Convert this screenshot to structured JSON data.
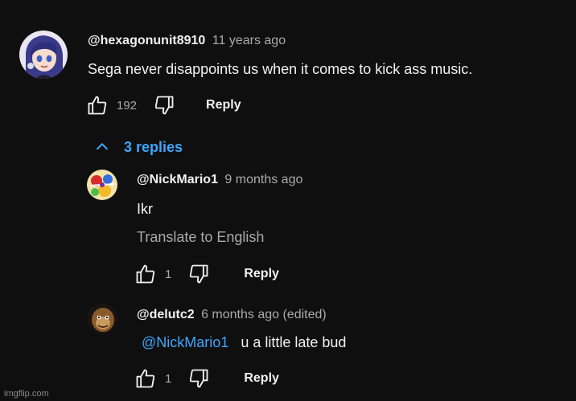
{
  "top_comment": {
    "handle": "@hexagonunit8910",
    "time": "11 years ago",
    "text": "Sega never disappoints us when it comes to kick ass music.",
    "likes": "192",
    "reply_label": "Reply"
  },
  "replies_toggle": {
    "label": "3 replies",
    "icon": "chevron-up-icon"
  },
  "replies": [
    {
      "handle": "@NickMario1",
      "time": "9 months ago",
      "text": "Ikr",
      "translate_label": "Translate to English",
      "likes": "1",
      "reply_label": "Reply"
    },
    {
      "handle": "@delutc2",
      "time": "6 months ago (edited)",
      "mention": "@NickMario1",
      "text": "u a little late bud",
      "likes": "1",
      "reply_label": "Reply"
    }
  ],
  "watermark": "imgflip.com",
  "colors": {
    "background": "#0f0f0f",
    "link": "#3ea6ff",
    "muted": "#aaaaaa",
    "text": "#f1f1f1"
  }
}
